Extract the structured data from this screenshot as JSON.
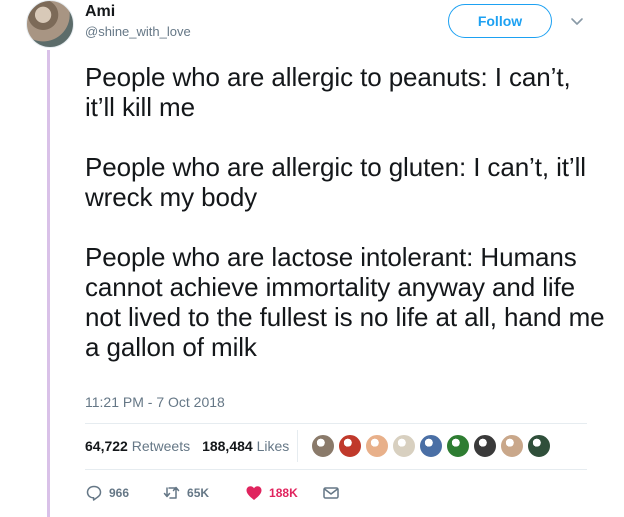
{
  "author": {
    "display_name": "Ami",
    "handle": "@shine_with_love"
  },
  "follow_label": "Follow",
  "tweet": {
    "paragraphs": [
      "People who are allergic to peanuts: I can’t, it’ll kill me",
      "People who are allergic to gluten: I can’t, it’ll wreck my body",
      "People who are lactose intolerant: Humans cannot achieve immortality anyway and life not lived to the fullest is no life at all, hand me a gallon of milk"
    ],
    "timestamp": "11:21 PM - 7 Oct 2018"
  },
  "stats": {
    "retweets_count": "64,722",
    "retweets_label": "Retweets",
    "likes_count": "188,484",
    "likes_label": "Likes"
  },
  "likers": [
    {
      "color": "#8a7a6a"
    },
    {
      "color": "#c0392b"
    },
    {
      "color": "#e8b08a"
    },
    {
      "color": "#d8d0c0"
    },
    {
      "color": "#4a6fa5"
    },
    {
      "color": "#2e7d32"
    },
    {
      "color": "#3a3a3a"
    },
    {
      "color": "#c9a78a"
    },
    {
      "color": "#2f4f3a"
    }
  ],
  "actions": {
    "reply_count": "966",
    "retweet_count": "65K",
    "like_count": "188K"
  },
  "colors": {
    "accent": "#1da1f2",
    "like": "#e0245e",
    "thread_line": "#d9c1e8"
  }
}
